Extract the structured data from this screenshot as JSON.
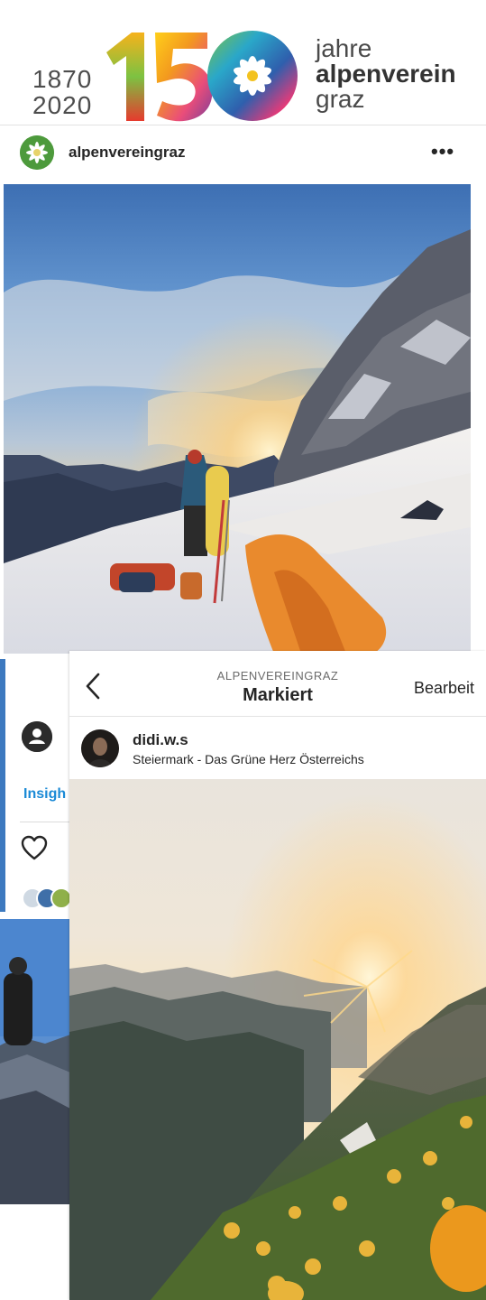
{
  "logo": {
    "year_start": "1870",
    "year_end": "2020",
    "number": "150",
    "word1": "jahre",
    "word2": "alpenverein",
    "word3": "graz"
  },
  "post": {
    "username": "alpenvereingraz",
    "more_label": "•••"
  },
  "underlying": {
    "insights_label": "Insigh"
  },
  "panel": {
    "kicker": "ALPENVEREINGRAZ",
    "title": "Markiert",
    "edit_label": "Bearbeit",
    "tagged_user": "didi.w.s",
    "tagged_location": "Steiermark - Das Grüne Herz Österreichs"
  },
  "icons": [
    "edelweiss-icon",
    "more-icon",
    "back-chevron-icon",
    "heart-icon",
    "person-icon"
  ],
  "colors": {
    "link_blue": "#1b8ad6",
    "text_dark": "#262626",
    "logo_green": "#4d9a3c"
  }
}
